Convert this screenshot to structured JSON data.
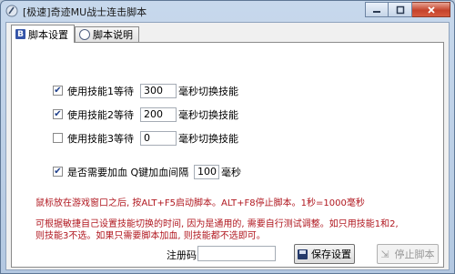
{
  "window": {
    "title": "[极速]奇迹MU战士连击脚本"
  },
  "tabs": [
    {
      "label": "脚本设置",
      "active": true
    },
    {
      "label": "脚本说明",
      "active": false
    }
  ],
  "skills": [
    {
      "checked": true,
      "label_prefix": "使用技能1等待",
      "value": "300",
      "label_suffix": "毫秒切换技能"
    },
    {
      "checked": true,
      "label_prefix": "使用技能2等待",
      "value": "200",
      "label_suffix": "毫秒切换技能"
    },
    {
      "checked": false,
      "label_prefix": "使用技能3等待",
      "value": "0",
      "label_suffix": "毫秒切换技能"
    }
  ],
  "heal": {
    "checked": true,
    "label_prefix": "是否需要加血  Q键加血间隔",
    "value": "100",
    "label_suffix": "毫秒"
  },
  "info": {
    "line1": "鼠标放在游戏窗口之后, 按ALT+F5启动脚本。ALT+F8停止脚本。1秒=1000毫秒",
    "line2": "可根据敏捷自己设置技能切换的时间, 因为是通用的, 需要自行测试调整。如只用技能1和2,",
    "line3": "则技能3不选。如果只需要脚本加血, 则技能都不选即可。"
  },
  "register": {
    "label": "注册码",
    "value": ""
  },
  "buttons": {
    "save": "保存设置",
    "stop": "停止脚本"
  },
  "colors": {
    "info_text": "#b0171f",
    "titlebar": "#c2d4ea"
  }
}
